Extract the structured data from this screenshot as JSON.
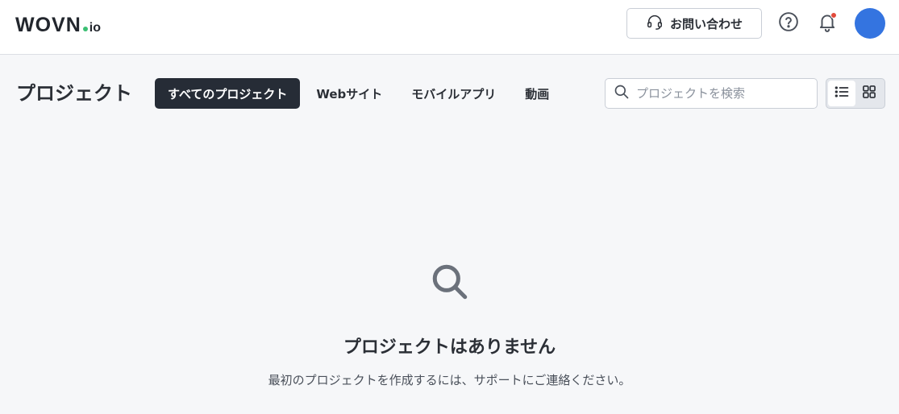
{
  "header": {
    "logo_main": "WOVN",
    "logo_suffix": "io",
    "contact_label": "お問い合わせ"
  },
  "page": {
    "title": "プロジェクト"
  },
  "tabs": [
    {
      "label": "すべてのプロジェクト",
      "active": true
    },
    {
      "label": "Webサイト",
      "active": false
    },
    {
      "label": "モバイルアプリ",
      "active": false
    },
    {
      "label": "動画",
      "active": false
    }
  ],
  "search": {
    "placeholder": "プロジェクトを検索",
    "value": ""
  },
  "view_toggle": {
    "list_icon": "list-icon",
    "grid_icon": "grid-icon",
    "selected": "list"
  },
  "empty_state": {
    "icon": "search-icon",
    "title": "プロジェクトはありません",
    "description": "最初のプロジェクトを作成するには、サポートにご連絡ください。"
  },
  "colors": {
    "accent": "#262c36",
    "avatar": "#3474e0",
    "notification": "#e24a3b",
    "logo_dot": "#3bbf73"
  }
}
